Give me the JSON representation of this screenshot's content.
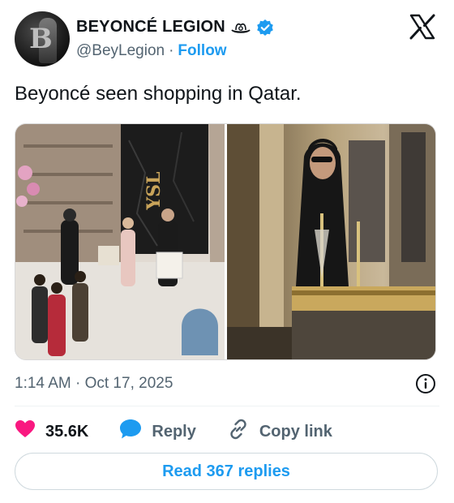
{
  "author": {
    "display_name": "BEYONCÉ LEGION",
    "handle": "@BeyLegion",
    "separator": "·",
    "follow_label": "Follow"
  },
  "icons": {
    "emoji": "cowboy-hat-icon",
    "verified": "verified-badge-icon",
    "platform": "x-logo-icon",
    "info": "info-icon",
    "like": "heart-icon",
    "reply": "speech-bubble-icon",
    "copy": "link-icon"
  },
  "tweet": {
    "text": "Beyoncé seen shopping in Qatar."
  },
  "logo_text": "YSL",
  "meta": {
    "timestamp": "1:14 AM · Oct 17, 2025"
  },
  "actions": {
    "like_count": "35.6K",
    "reply_label": "Reply",
    "copy_label": "Copy link"
  },
  "replies": {
    "read_label": "Read 367 replies"
  },
  "colors": {
    "accent": "#1d9bf0",
    "like": "#f91880",
    "text": "#0f1419",
    "secondary": "#536471"
  }
}
